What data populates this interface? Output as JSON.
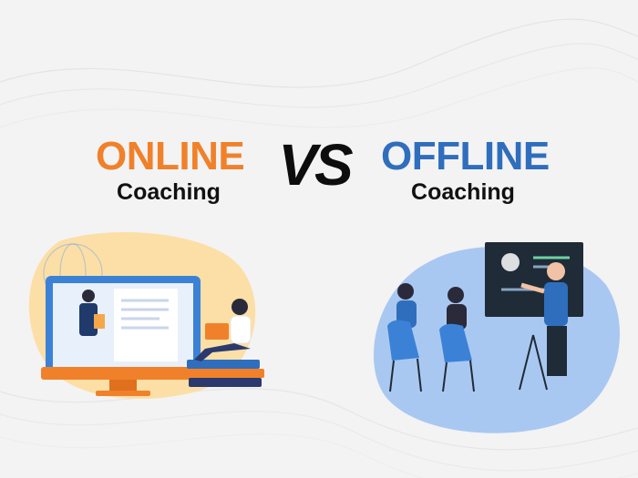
{
  "online": {
    "heading": "ONLINE",
    "subheading": "Coaching"
  },
  "vs": "VS",
  "offline": {
    "heading": "OFFLINE",
    "subheading": "Coaching"
  },
  "colors": {
    "online_accent": "#f0812a",
    "offline_accent": "#2f6ebd",
    "text": "#111111"
  }
}
